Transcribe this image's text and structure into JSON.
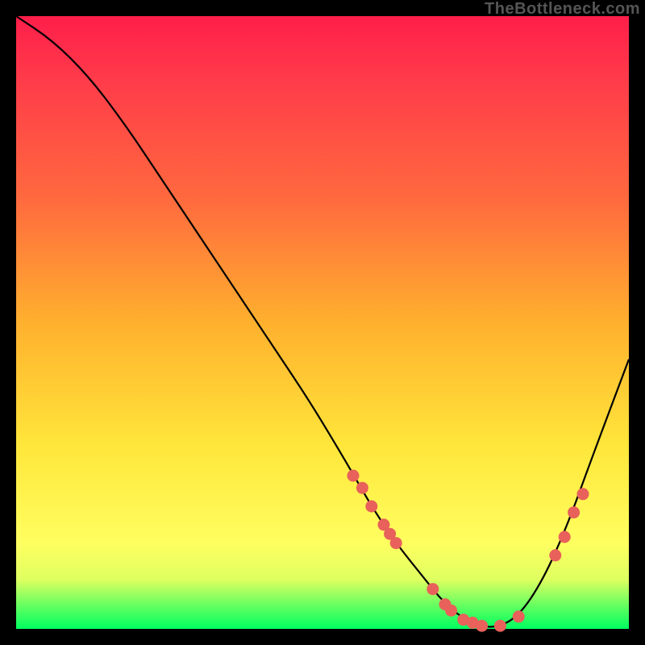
{
  "attribution": "TheBottleneck.com",
  "colors": {
    "marker": "#e8615a",
    "curve": "#000000"
  },
  "chart_data": {
    "type": "line",
    "title": "",
    "xlabel": "",
    "ylabel": "",
    "xlim": [
      0,
      100
    ],
    "ylim": [
      0,
      100
    ],
    "series": [
      {
        "name": "curve",
        "x": [
          0,
          6,
          12,
          18,
          24,
          30,
          36,
          42,
          48,
          54,
          58,
          62,
          66,
          70,
          74,
          78,
          82,
          86,
          90,
          94,
          100
        ],
        "y": [
          100,
          96,
          90,
          82,
          73,
          64,
          55,
          46,
          37,
          27,
          20,
          14,
          9,
          4,
          1,
          0,
          2,
          8,
          17,
          28,
          44
        ]
      }
    ],
    "markers": {
      "name": "highlighted-points",
      "x": [
        55,
        56.5,
        58,
        60,
        61,
        62,
        68,
        70,
        71,
        73,
        74.5,
        76,
        79,
        82,
        88,
        89.5,
        91,
        92.5
      ],
      "y": [
        25,
        23,
        20,
        17,
        15.5,
        14,
        6.5,
        4,
        3,
        1.5,
        1,
        0.5,
        0.5,
        2,
        12,
        15,
        19,
        22
      ]
    }
  }
}
